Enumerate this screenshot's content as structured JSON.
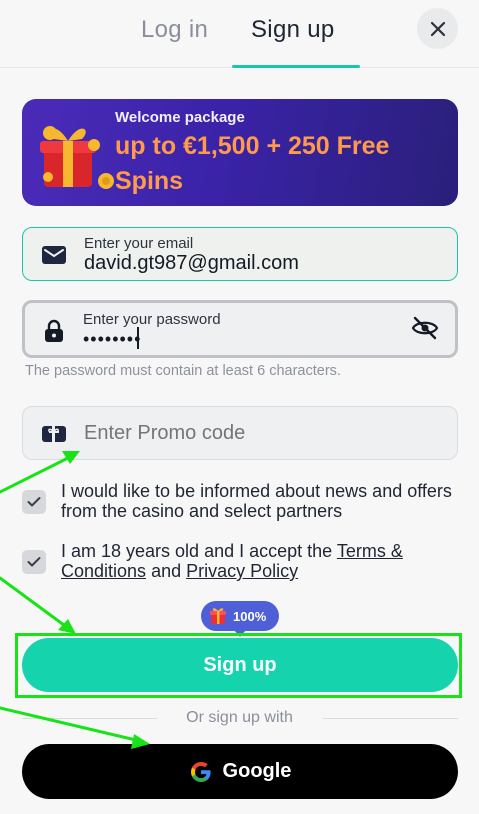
{
  "tabs": {
    "login": "Log in",
    "signup": "Sign up"
  },
  "banner": {
    "subtitle": "Welcome package",
    "title": "up to €1,500 + 250 Free Spins"
  },
  "email": {
    "label": "Enter your email",
    "value": "david.gt987@gmail.com"
  },
  "password": {
    "label": "Enter your password",
    "value": "••••••••",
    "hint": "The password must contain at least 6 characters."
  },
  "promo": {
    "placeholder": "Enter Promo code"
  },
  "checkboxes": {
    "news": "I would like to be informed about news and offers from the casino and select partners",
    "age_prefix": "I am 18 years old and I accept the ",
    "terms_link": "Terms & Conditions",
    "age_and": " and ",
    "privacy_link": "Privacy Policy"
  },
  "badge": {
    "text": "100%"
  },
  "signup_button": "Sign up",
  "divider_text": "Or sign up with",
  "google_button": "Google",
  "colors": {
    "accent": "#14d3ad",
    "banner_text": "#ff9a4d",
    "badge": "#4e5fd8",
    "annotation": "#18e318"
  },
  "icons": [
    "close-icon",
    "gift-icon",
    "envelope-icon",
    "lock-icon",
    "eye-off-icon",
    "promo-ticket-icon",
    "check-icon",
    "google-icon"
  ]
}
